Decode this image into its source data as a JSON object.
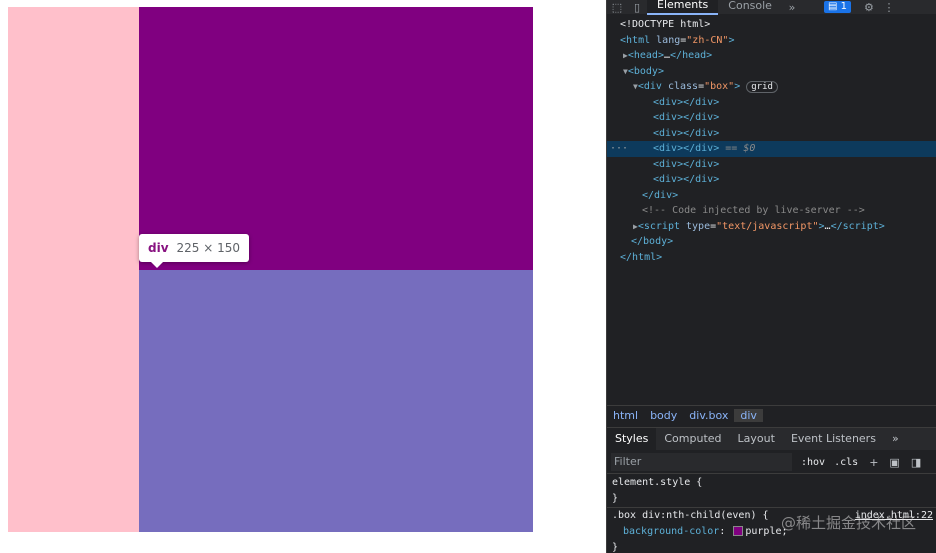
{
  "page": {
    "colors": {
      "pink": "#ffc0cb",
      "purple": "#800080",
      "lavender": "#766dbe"
    },
    "tooltip": {
      "tag": "div",
      "dims": "225 × 150"
    }
  },
  "devtools": {
    "tabs": [
      "Elements",
      "Console"
    ],
    "active_tab": "Elements",
    "more_tabs_icon": "chevron-double-right",
    "issues_count": "1",
    "dom": {
      "doctype": "<!DOCTYPE html>",
      "html_open_tag": "html",
      "html_attr_name": "lang",
      "html_attr_value": "\"zh-CN\"",
      "head": "head",
      "head_collapsed": "…",
      "body": "body",
      "box_tag": "div",
      "box_attr_name": "class",
      "box_attr_value": "\"box\"",
      "box_badge": "grid",
      "children": [
        "<div></div>",
        "<div></div>",
        "<div></div>",
        "<div></div>",
        "<div></div>",
        "<div></div>"
      ],
      "selected_suffix": "== $0",
      "comment": "<!-- Code injected by live-server -->",
      "script_tag": "script",
      "script_attr_name": "type",
      "script_attr_value": "\"text/javascript\"",
      "script_collapsed": "…",
      "close_div": "</div>",
      "close_body": "</body>",
      "close_html": "</html>"
    },
    "breadcrumbs": [
      "html",
      "body",
      "div.box",
      "div"
    ],
    "subtabs": [
      "Styles",
      "Computed",
      "Layout",
      "Event Listeners"
    ],
    "active_subtab": "Styles",
    "filter_placeholder": "Filter",
    "filter_options": [
      ":hov",
      ".cls"
    ],
    "styles": {
      "element_style": "element.style {",
      "element_close": "}",
      "rule_selector": ".box div:nth-child(even) {",
      "rule_source": "index.html:22",
      "rule_property": "background-color",
      "rule_value": "purple;",
      "rule_swatch_color": "#800080",
      "rule_close": "}"
    }
  },
  "watermark": "@稀土掘金技术社区"
}
